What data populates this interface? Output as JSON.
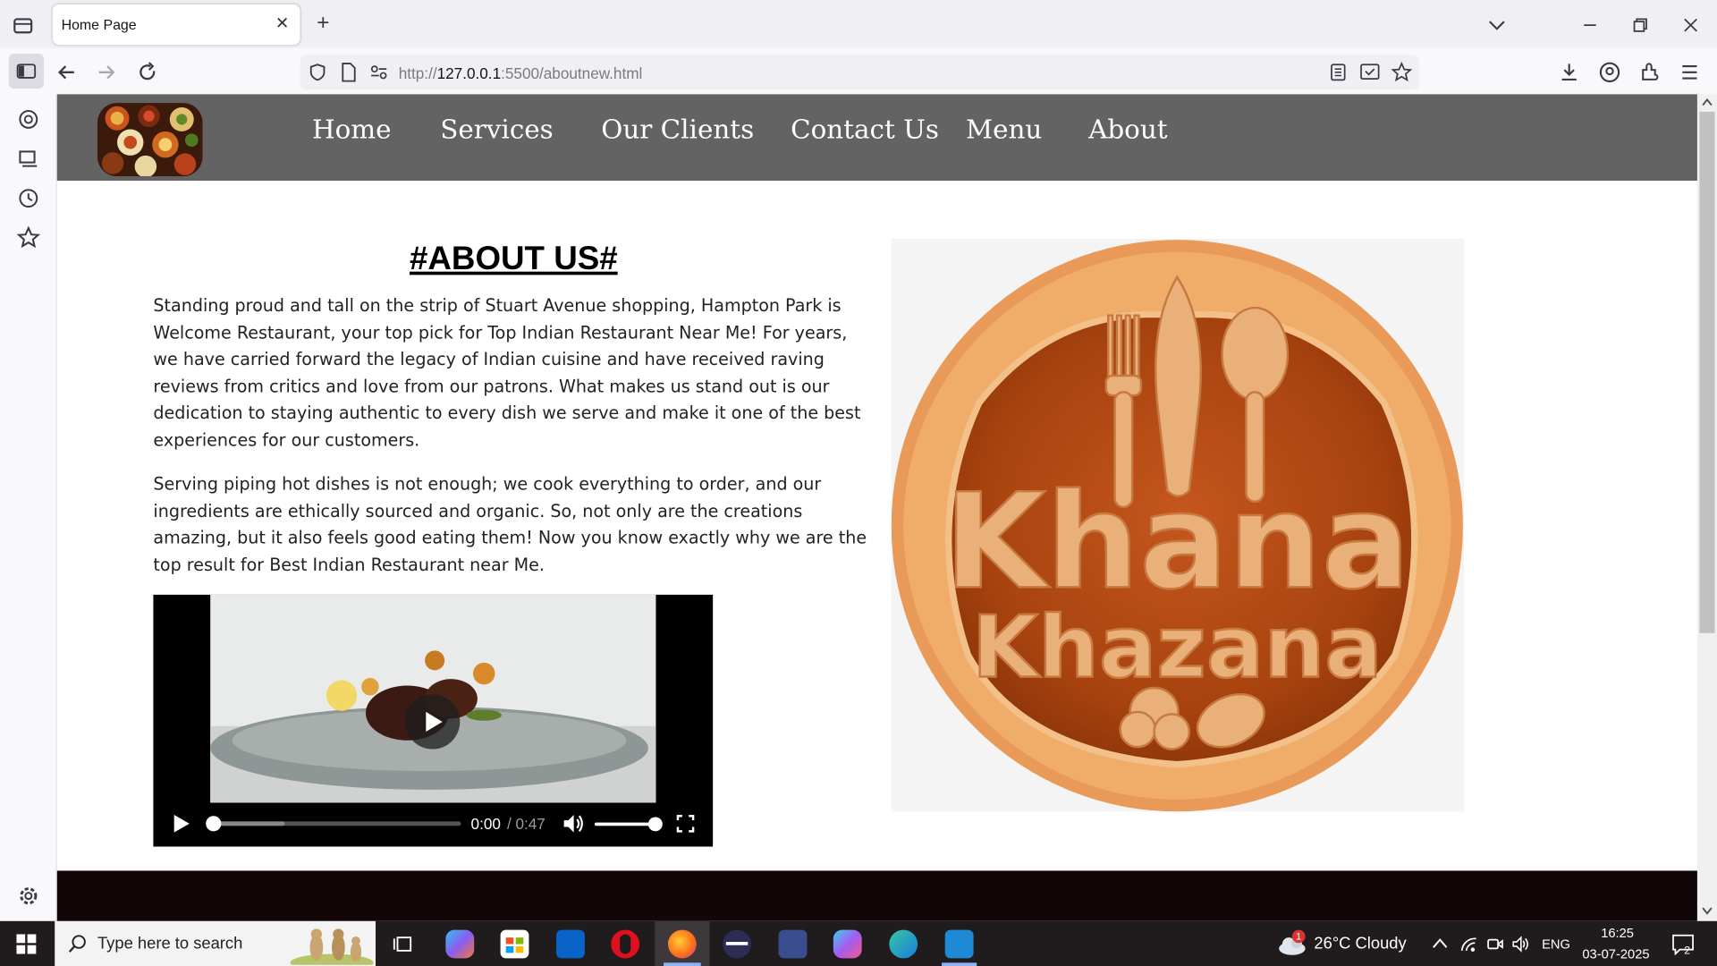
{
  "browser": {
    "tab_title": "Home Page",
    "tab_close": "✕",
    "new_tab": "+",
    "url_prefix": "http://",
    "url_host": "127.0.0.1",
    "url_rest": ":5500/aboutnew.html"
  },
  "nav": {
    "links": [
      "Home",
      "Services",
      "Our Clients",
      "Contact Us",
      "Menu",
      "About"
    ]
  },
  "about": {
    "title": "#ABOUT US#",
    "paragraph1": "Standing proud and tall on the strip of Stuart Avenue shopping, Hampton Park is Welcome Restaurant, your top pick for Top Indian Restaurant Near Me! For years, we have carried forward the legacy of Indian cuisine and have received raving reviews from critics and love from our patrons. What makes us stand out is our dedication to staying authentic to every dish we serve and make it one of the best experiences for our customers.",
    "paragraph2": "Serving piping hot dishes is not enough; we cook everything to order, and our ingredients are ethically sourced and organic. So, not only are the creations amazing, but it also feels good eating them! Now you know exactly why we are the top result for Best Indian Restaurant near Me."
  },
  "video": {
    "current_time": "0:00",
    "duration": "/ 0:47",
    "progress": 0,
    "volume": 1
  },
  "logo": {
    "line1": "Khana",
    "line2": "Khazana"
  },
  "taskbar": {
    "search_placeholder": "Type here to search",
    "weather": "26°C  Cloudy",
    "weather_badge": "1",
    "language": "ENG",
    "time": "16:25",
    "date": "03-07-2025",
    "notifications": "2"
  },
  "colors": {
    "nav_bg": "#636363",
    "footer_bg": "#120608",
    "logo_wood": "#c8622a"
  }
}
